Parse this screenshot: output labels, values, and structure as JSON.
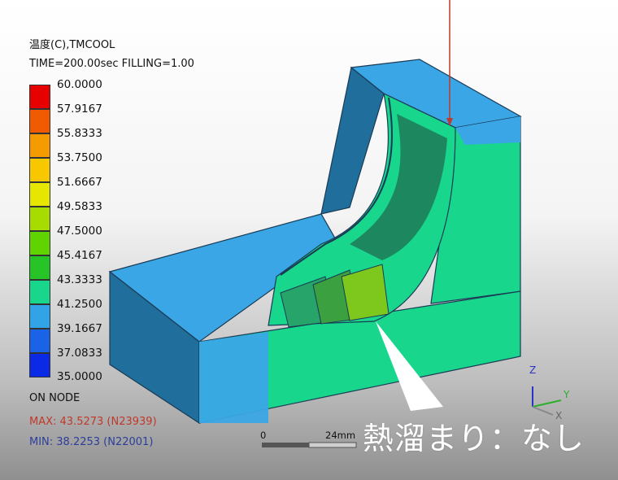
{
  "legend": {
    "title": "温度(C),TMCOOL",
    "subtitle": "TIME=200.00sec FILLING=1.00",
    "entries": [
      {
        "label": "60.0000",
        "color": "#e60000"
      },
      {
        "label": "57.9167",
        "color": "#f05a00"
      },
      {
        "label": "55.8333",
        "color": "#f59a00"
      },
      {
        "label": "53.7500",
        "color": "#f7c700"
      },
      {
        "label": "51.6667",
        "color": "#e6e600"
      },
      {
        "label": "49.5833",
        "color": "#a8dc00"
      },
      {
        "label": "47.5000",
        "color": "#5fd400"
      },
      {
        "label": "45.4167",
        "color": "#27c427"
      },
      {
        "label": "43.3333",
        "color": "#18d68c"
      },
      {
        "label": "41.2500",
        "color": "#30a4e6"
      },
      {
        "label": "39.1667",
        "color": "#1a63e6"
      },
      {
        "label": "37.0833",
        "color": "#0a2ae6"
      }
    ],
    "min_label": "35.0000",
    "node_mode": "ON NODE",
    "max_text": "MAX: 43.5273 (N23939)",
    "min_text": "MIN: 38.2253 (N22001)",
    "max_color": "#c0392b",
    "min_color": "#2c3e9a"
  },
  "scale_bar": {
    "start": "0",
    "end": "24mm"
  },
  "axes": {
    "z": "Z",
    "y": "Y",
    "x": "X"
  },
  "annotation": {
    "text": "熱溜まり：なし"
  }
}
